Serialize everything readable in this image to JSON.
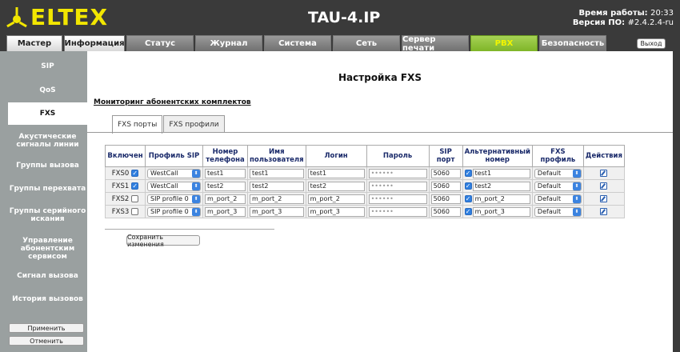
{
  "header": {
    "brand": "ELTEX",
    "device": "TAU-4.IP",
    "uptime_label": "Время работы:",
    "uptime_value": "20:33",
    "version_label": "Версия ПО:",
    "version_value": "#2.4.2.4-ru"
  },
  "tabs": [
    {
      "label": "Мастер"
    },
    {
      "label": "Информация"
    },
    {
      "label": "Статус"
    },
    {
      "label": "Журнал"
    },
    {
      "label": "Система"
    },
    {
      "label": "Сеть"
    },
    {
      "label": "Сервер печати"
    },
    {
      "label": "PBX"
    },
    {
      "label": "Безопасность"
    }
  ],
  "logout_label": "Выход",
  "sidebar": {
    "items": [
      {
        "label": "SIP"
      },
      {
        "label": "QoS"
      },
      {
        "label": "FXS"
      },
      {
        "label": "Акустические сигналы линии"
      },
      {
        "label": "Группы вызова"
      },
      {
        "label": "Группы перехвата"
      },
      {
        "label": "Группы серийного искания"
      },
      {
        "label": "Управление абонентским сервисом"
      },
      {
        "label": "Сигнал вызова"
      },
      {
        "label": "История вызовов"
      }
    ],
    "apply_label": "Применить",
    "cancel_label": "Отменить"
  },
  "main": {
    "title": "Настройка FXS",
    "section": "Мониторинг абонентских комплектов",
    "subtabs": [
      {
        "label": "FXS порты"
      },
      {
        "label": "FXS профили"
      }
    ],
    "columns": [
      "Включен",
      "Профиль SIP",
      "Номер телефона",
      "Имя пользователя",
      "Логин",
      "Пароль",
      "SIP порт",
      "Альтернативный номер",
      "FXS профиль",
      "Действия"
    ],
    "rows": [
      {
        "port": "FXS0",
        "enabled": true,
        "sip_profile": "WestCall",
        "phone": "test1",
        "user": "test1",
        "login": "test1",
        "password": "••••••",
        "sip_port": "5060",
        "alt_checked": true,
        "alt": "test1",
        "fxs_profile": "Default"
      },
      {
        "port": "FXS1",
        "enabled": true,
        "sip_profile": "WestCall",
        "phone": "test2",
        "user": "test2",
        "login": "test2",
        "password": "••••••",
        "sip_port": "5060",
        "alt_checked": true,
        "alt": "test2",
        "fxs_profile": "Default"
      },
      {
        "port": "FXS2",
        "enabled": false,
        "sip_profile": "SIP profile 0",
        "phone": "m_port_2",
        "user": "m_port_2",
        "login": "m_port_2",
        "password": "••••••",
        "sip_port": "5060",
        "alt_checked": true,
        "alt": "m_port_2",
        "fxs_profile": "Default"
      },
      {
        "port": "FXS3",
        "enabled": false,
        "sip_profile": "SIP profile 0",
        "phone": "m_port_3",
        "user": "m_port_3",
        "login": "m_port_3",
        "password": "••••••",
        "sip_port": "5060",
        "alt_checked": true,
        "alt": "m_port_3",
        "fxs_profile": "Default"
      }
    ],
    "save_label": "Сохранить изменения"
  }
}
